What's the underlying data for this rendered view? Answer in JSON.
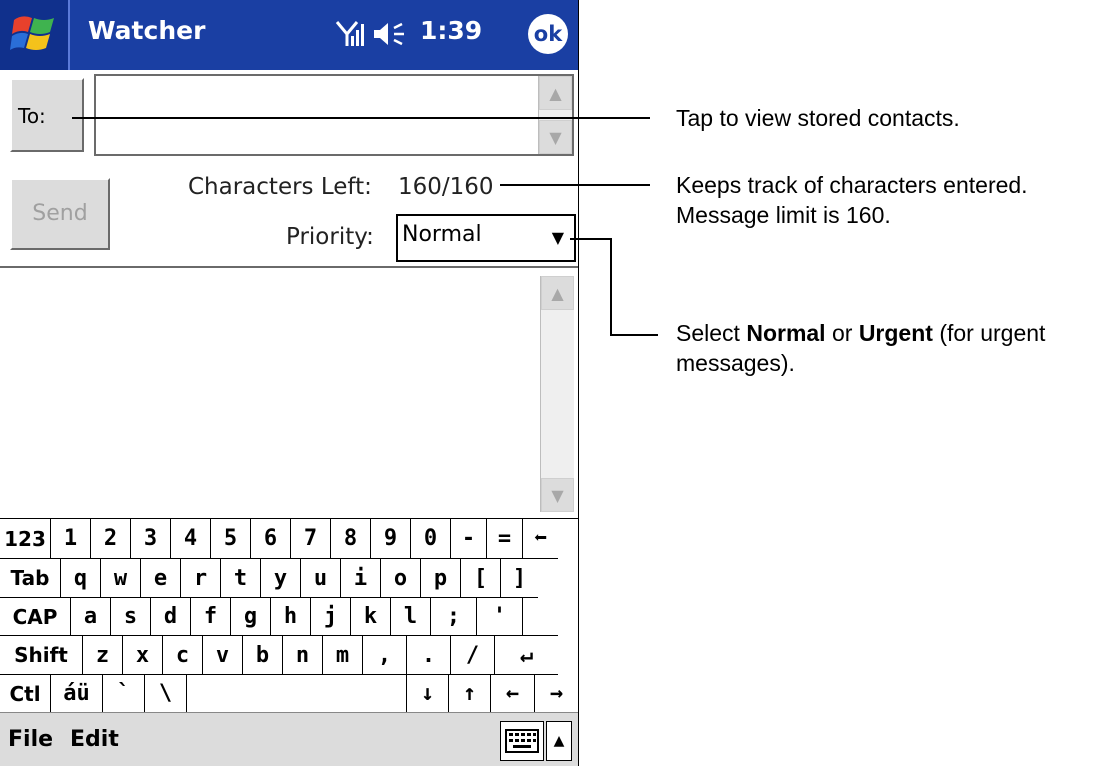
{
  "window": {
    "title": "Watcher",
    "clock": "1:39",
    "ok_label": "ok"
  },
  "header": {
    "to_label": "To:",
    "chars_left_label": "Characters Left:",
    "chars_left_value": "160/160",
    "priority_label": "Priority:",
    "priority_value": "Normal",
    "send_label": "Send"
  },
  "keyboard": {
    "rows": [
      [
        "123",
        "1",
        "2",
        "3",
        "4",
        "5",
        "6",
        "7",
        "8",
        "9",
        "0",
        "-",
        "=",
        "⬅"
      ],
      [
        "Tab",
        "q",
        "w",
        "e",
        "r",
        "t",
        "y",
        "u",
        "i",
        "o",
        "p",
        "[",
        "]"
      ],
      [
        "CAP",
        "a",
        "s",
        "d",
        "f",
        "g",
        "h",
        "j",
        "k",
        "l",
        ";",
        "'",
        ""
      ],
      [
        "Shift",
        "z",
        "x",
        "c",
        "v",
        "b",
        "n",
        "m",
        ",",
        ".",
        "/",
        "↵"
      ],
      [
        "Ctl",
        "áü",
        "`",
        "\\",
        "",
        "↓",
        "↑",
        "←",
        "→"
      ]
    ]
  },
  "menubar": {
    "file": "File",
    "edit": "Edit"
  },
  "callouts": {
    "contacts": "Tap to view stored contacts.",
    "chars_line1": "Keeps track of characters entered.",
    "chars_line2": "Message limit is 160.",
    "priority_select": "Select ",
    "priority_normal": "Normal",
    "priority_or": " or ",
    "priority_urgent": "Urgent",
    "priority_rest1": " (for urgent",
    "priority_line2": "messages)."
  }
}
